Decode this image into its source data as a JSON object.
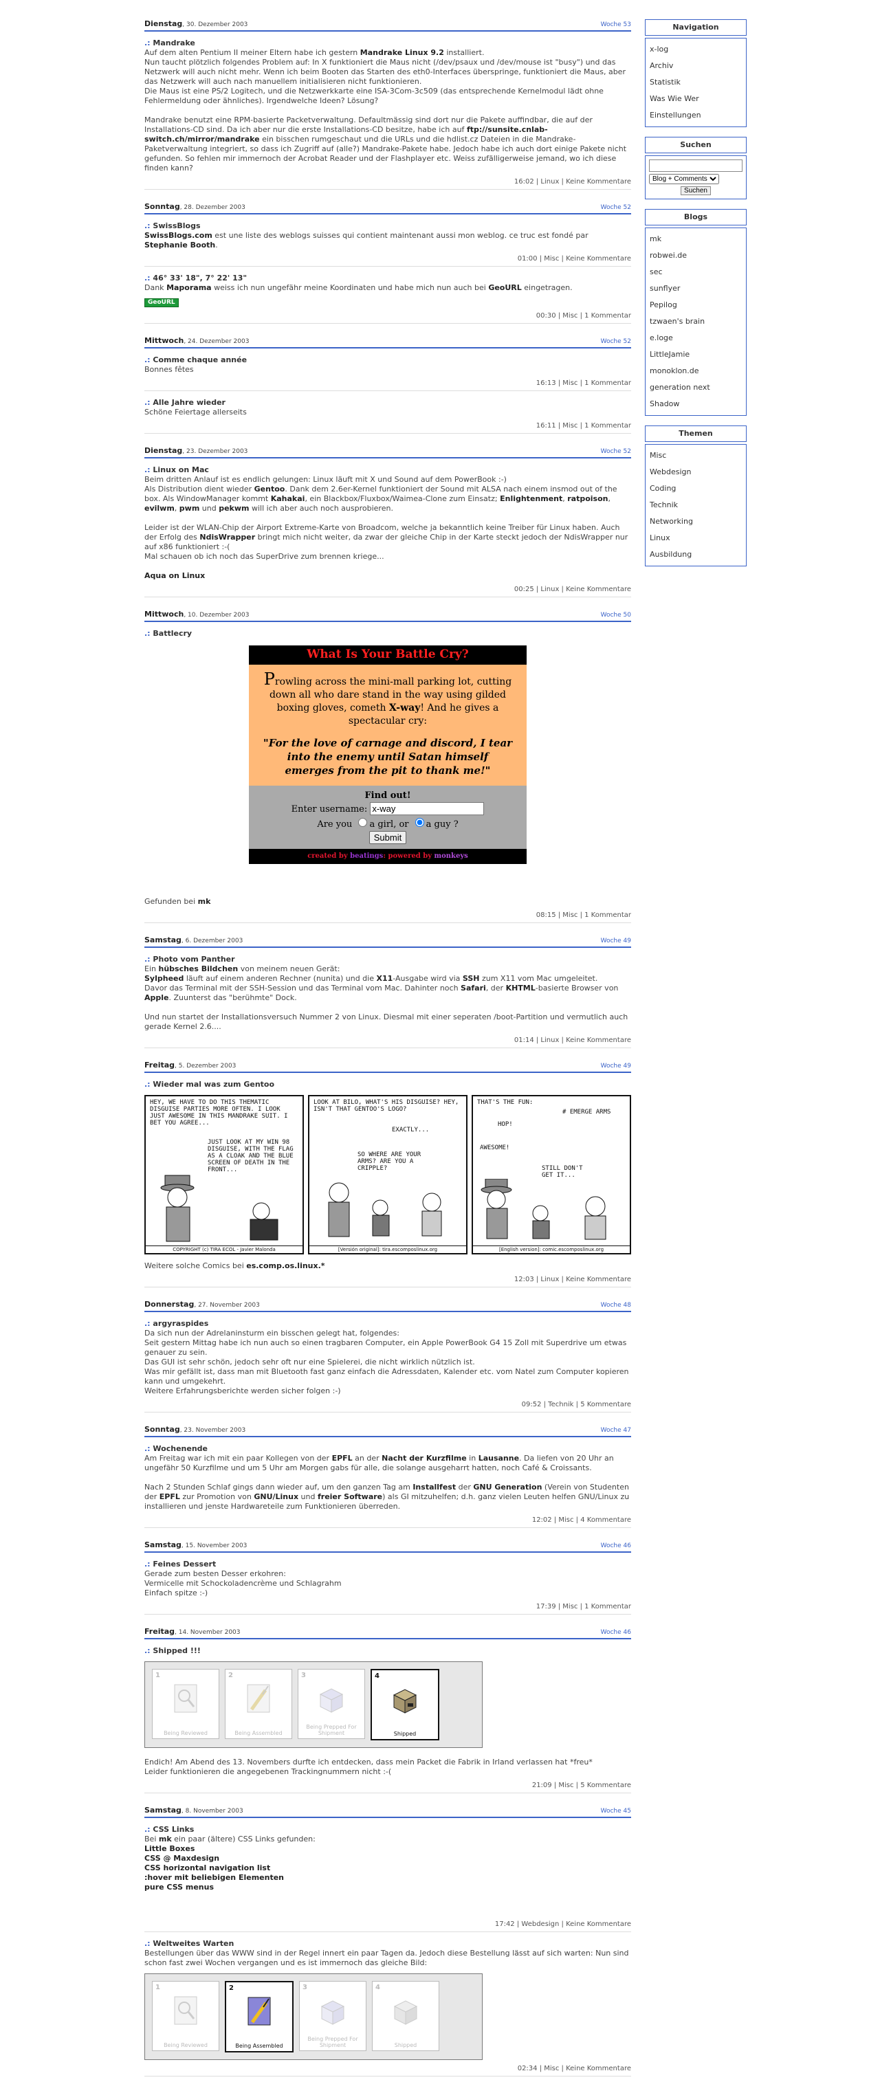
{
  "sidebar": {
    "nav_title": "Navigation",
    "nav_items": [
      "x-log",
      "Archiv",
      "Statistik",
      "Was Wie Wer",
      "Einstellungen"
    ],
    "search_title": "Suchen",
    "search_select": "Blog + Comments",
    "search_button": "Suchen",
    "blogs_title": "Blogs",
    "blogs": [
      "mk",
      "robwei.de",
      "sec",
      "sunflyer",
      "Pepilog",
      "tzwaen's brain",
      "e.loge",
      "LittleJamie",
      "monoklon.de",
      "generation next",
      "Shadow"
    ],
    "themes_title": "Themen",
    "themes": [
      "Misc",
      "Webdesign",
      "Coding",
      "Technik",
      "Networking",
      "Linux",
      "Ausbildung"
    ]
  },
  "days": {
    "d1": {
      "name": "Dienstag",
      "date": ", 30. Dezember 2003",
      "week": "Woche 53"
    },
    "d2": {
      "name": "Sonntag",
      "date": ", 28. Dezember 2003",
      "week": "Woche 52"
    },
    "d3": {
      "name": "Mittwoch",
      "date": ", 24. Dezember 2003",
      "week": "Woche 52"
    },
    "d4": {
      "name": "Dienstag",
      "date": ", 23. Dezember 2003",
      "week": "Woche 52"
    },
    "d5": {
      "name": "Mittwoch",
      "date": ", 10. Dezember 2003",
      "week": "Woche 50"
    },
    "d6": {
      "name": "Samstag",
      "date": ", 6. Dezember 2003",
      "week": "Woche 49"
    },
    "d7": {
      "name": "Freitag",
      "date": ", 5. Dezember 2003",
      "week": "Woche 49"
    },
    "d8": {
      "name": "Donnerstag",
      "date": ", 27. November 2003",
      "week": "Woche 48"
    },
    "d9": {
      "name": "Sonntag",
      "date": ", 23. November 2003",
      "week": "Woche 47"
    },
    "d10": {
      "name": "Samstag",
      "date": ", 15. November 2003",
      "week": "Woche 46"
    },
    "d11": {
      "name": "Freitag",
      "date": ", 14. November 2003",
      "week": "Woche 46"
    },
    "d12": {
      "name": "Samstag",
      "date": ", 8. November 2003",
      "week": "Woche 45"
    }
  },
  "posts": {
    "mandrake": {
      "marker": ".:",
      "title": "Mandrake",
      "footer": "16:02 | Linux | Keine Kommentare"
    },
    "swissblogs": {
      "marker": ".:",
      "title": "SwissBlogs",
      "footer": "01:00 | Misc | Keine Kommentare"
    },
    "coords": {
      "marker": ".:",
      "title": "46° 33' 18\", 7° 22' 13\"",
      "footer": "00:30 | Misc | 1 Kommentar",
      "badge": "GeoURL"
    },
    "annee": {
      "marker": ".:",
      "title": "Comme chaque année",
      "body": "Bonnes fêtes",
      "footer": "16:13 | Misc | 1 Kommentar"
    },
    "jahre": {
      "marker": ".:",
      "title": "Alle Jahre wieder",
      "body": "Schöne Feiertage allerseits",
      "footer": "16:11 | Misc | 1 Kommentar"
    },
    "linuxmac": {
      "marker": ".:",
      "title": "Linux on Mac",
      "footer": "00:25 | Linux | Keine Kommentare"
    },
    "battle": {
      "marker": ".:",
      "title": "Battlecry",
      "found": "Gefunden bei",
      "found_name": "mk",
      "footer": "08:15 | Misc | 1 Kommentar"
    },
    "panther": {
      "marker": ".:",
      "title": "Photo vom Panther",
      "footer": "01:14 | Linux | Keine Kommentare"
    },
    "gentoo": {
      "marker": ".:",
      "title": "Wieder mal was zum Gentoo",
      "more": "Weitere solche Comics bei",
      "more_name": "es.comp.os.linux.*",
      "footer": "12:03 | Linux | Keine Kommentare"
    },
    "argy": {
      "marker": ".:",
      "title": "argyraspides",
      "footer": "09:52 | Technik | 5 Kommentare"
    },
    "wochenende": {
      "marker": ".:",
      "title": "Wochenende",
      "footer": "12:02 | Misc | 4 Kommentare"
    },
    "dessert": {
      "marker": ".:",
      "title": "Feines Dessert",
      "footer": "17:39 | Misc | 1 Kommentar"
    },
    "shipped": {
      "marker": ".:",
      "title": "Shipped !!!",
      "footer": "21:09 | Misc | 5 Kommentare"
    },
    "css": {
      "marker": ".:",
      "title": "CSS Links",
      "footer": "17:42 | Webdesign | Keine Kommentare"
    },
    "warten": {
      "marker": ".:",
      "title": "Weltweites Warten",
      "footer": "02:34 | Misc | Keine Kommentare"
    }
  },
  "battlecry": {
    "title": "What Is Your Battle Cry?",
    "text_big": "P",
    "text_rest": "rowling across the mini-mall parking lot, cutting down all who dare stand in the way using gilded boxing gloves, cometh",
    "text_name": "X-way",
    "text_end": "! And he gives a spectacular cry:",
    "quote": "\"For the love of carnage and discord, I tear into the enemy until Satan himself emerges from the pit to thank me!\"",
    "find_out": "Find out!",
    "username_label": "Enter username:",
    "username_value": "x-way",
    "are_you": "Are you",
    "girl": "a girl, or",
    "guy": "a guy ?",
    "submit": "Submit",
    "credit": "created by",
    "credit_a": "beatings",
    "credit_mid": ": powered by",
    "credit_b": "monkeys"
  },
  "comic": {
    "p1_text": "HEY, WE HAVE TO DO THIS THEMATIC DISGUISE PARTIES MORE OFTEN. I LOOK JUST AWESOME IN THIS MANDRAKE SUIT. I BET YOU AGREE...",
    "p1_text2": "JUST LOOK AT MY WIN 98 DISGUISE, WITH THE FLAG AS A CLOAK AND THE BLUE SCREEN OF DEATH IN THE FRONT...",
    "p1_cap": "COPYRIGHT (c) TIRA ECOL - Javier Malonda",
    "p2_text": "LOOK AT BILO, WHAT'S HIS DISGUISE? HEY, ISN'T THAT GENTOO'S LOGO?",
    "p2_text2": "EXACTLY...",
    "p2_text3": "SO WHERE ARE YOUR ARMS? ARE YOU A CRIPPLE?",
    "p2_cap": "[Versión original]: tira.escomposlinux.org",
    "p3_text": "THAT'S THE FUN:",
    "p3_text2": "# EMERGE ARMS",
    "p3_text3": "HOP!",
    "p3_text4": "AWESOME!",
    "p3_text5": "STILL DON'T GET IT...",
    "p3_cap": "[English version]: comic.escomposlinux.org"
  },
  "ship": {
    "s1": {
      "num": "1",
      "label": "Being Reviewed"
    },
    "s2": {
      "num": "2",
      "label": "Being Assembled"
    },
    "s3": {
      "num": "3",
      "label": "Being Prepped For Shipment"
    },
    "s4": {
      "num": "4",
      "label": "Shipped"
    }
  }
}
